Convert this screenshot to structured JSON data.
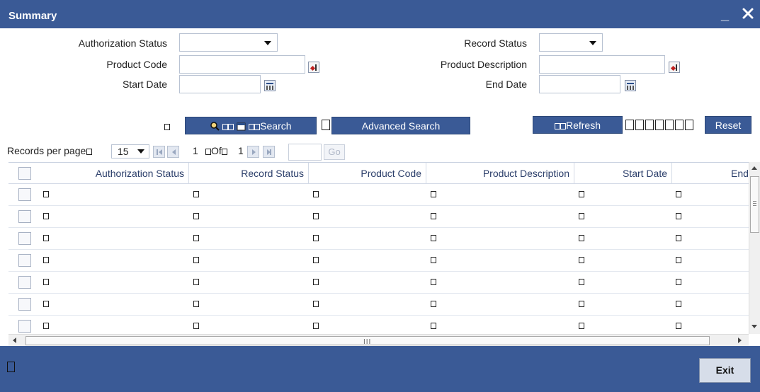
{
  "window": {
    "title": "Summary",
    "minimize_label": "_"
  },
  "form": {
    "authorization_status_label": "Authorization Status",
    "record_status_label": "Record Status",
    "product_code_label": "Product Code",
    "product_description_label": "Product Description",
    "start_date_label": "Start Date",
    "end_date_label": "End Date",
    "authorization_status_value": "",
    "record_status_value": "",
    "product_code_value": "",
    "product_description_value": "",
    "start_date_value": "",
    "end_date_value": ""
  },
  "actions": {
    "search_label": "Search",
    "advanced_search_label": "Advanced Search",
    "refresh_label": "Refresh",
    "reset_label": "Reset"
  },
  "pager": {
    "records_per_page_label": "Records per page",
    "records_per_page_value": "15",
    "current_page": "1",
    "of_label": "Of",
    "total_pages": "1",
    "go_label": "Go"
  },
  "grid": {
    "columns": [
      "Authorization Status",
      "Record Status",
      "Product Code",
      "Product Description",
      "Start Date",
      "End Da"
    ],
    "row_count": 7
  },
  "horizontal_scroll_grip": "III",
  "footer": {
    "exit_label": "Exit"
  },
  "colors": {
    "primary": "#3a5a96",
    "background": "#ffffff",
    "header_text": "#2b3e6a"
  }
}
